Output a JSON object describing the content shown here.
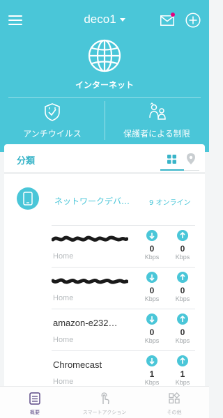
{
  "header": {
    "network_name": "deco1",
    "internet_label": "インターネット"
  },
  "features": {
    "antivirus": "アンチウイルス",
    "parental": "保護者による制限"
  },
  "card": {
    "title": "分類",
    "group": {
      "name": "ネットワークデバ…",
      "online": "9 オンライン"
    },
    "devices": [
      {
        "name": "",
        "subtitle": "Home",
        "down": "0",
        "up": "0",
        "unit": "Kbps"
      },
      {
        "name": "",
        "subtitle": "Home",
        "down": "0",
        "up": "0",
        "unit": "Kbps"
      },
      {
        "name": "amazon-e232…",
        "subtitle": "Home",
        "down": "0",
        "up": "0",
        "unit": "Kbps"
      },
      {
        "name": "Chromecast",
        "subtitle": "Home",
        "down": "1",
        "up": "1",
        "unit": "Kbps"
      }
    ]
  },
  "nav": {
    "overview": "概要",
    "smart_action": "スマートアクション",
    "other": "その他"
  },
  "colors": {
    "primary": "#4ac6d8",
    "accent": "#38b4c8",
    "notification": "#e5007e",
    "nav_active": "#5d4a86"
  },
  "icons": [
    "menu-icon",
    "chevron-down-icon",
    "mail-icon",
    "add-icon",
    "globe-icon",
    "shield-icon",
    "family-icon",
    "grid-icon",
    "location-pin-icon",
    "phone-icon",
    "download-arrow-icon",
    "upload-arrow-icon",
    "overview-icon",
    "smart-action-icon",
    "more-icon"
  ]
}
